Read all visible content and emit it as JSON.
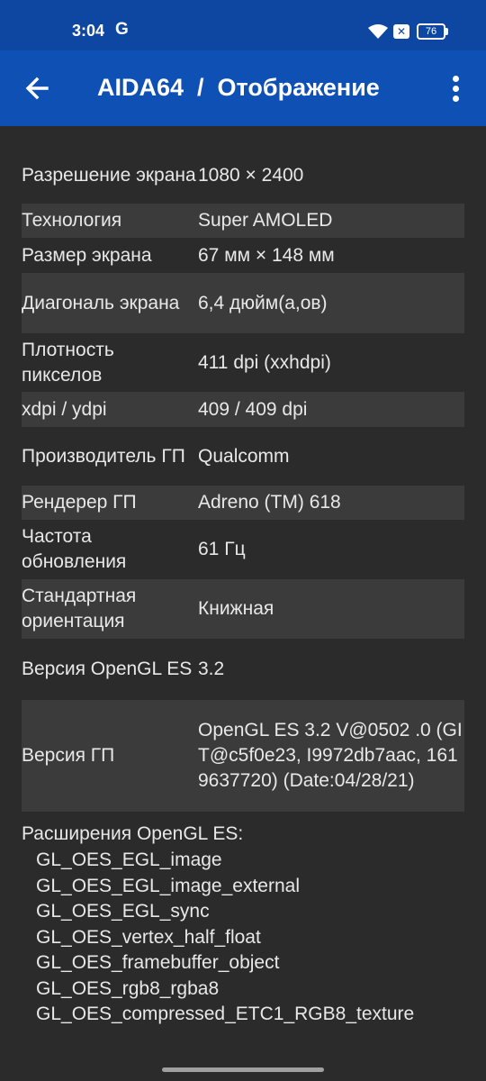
{
  "status_bar": {
    "time": "3:04",
    "g_icon": "G",
    "battery_level": "76",
    "icons": [
      "wifi-icon",
      "notification-x-icon",
      "battery-icon"
    ]
  },
  "app_bar": {
    "title": "AIDA64  /  Отображение",
    "back_icon": "arrow-left-icon",
    "menu_icon": "more-vert-icon",
    "color": "#0f50b4"
  },
  "rows": [
    {
      "label": "Разрешение экрана",
      "value": "1080 × 2400"
    },
    {
      "label": "Технология",
      "value": "Super AMOLED"
    },
    {
      "label": "Размер экрана",
      "value": "67 мм × 148 мм"
    },
    {
      "label": "Диагональ экрана",
      "value": "6,4 дюйм(а,ов)"
    },
    {
      "label": "Плотность пикселов",
      "value": "411 dpi (xxhdpi)"
    },
    {
      "label": "xdpi / ydpi",
      "value": "409 / 409 dpi"
    },
    {
      "label": "Производитель ГП",
      "value": "Qualcomm"
    },
    {
      "label": "Рендерер ГП",
      "value": "Adreno (TM) 618"
    },
    {
      "label": "Частота обновления",
      "value": "61 Гц"
    },
    {
      "label": "Стандартная ориентация",
      "value": "Книжная"
    },
    {
      "label": "Версия OpenGL ES",
      "value": "3.2"
    },
    {
      "label": "Версия ГП",
      "value": "OpenGL ES 3.2 V@0502 .0 (GIT@c5f0e23, I9972db7aac, 1619637720) (Date:04/28/21)"
    }
  ],
  "extensions": {
    "title": "Расширения OpenGL ES:",
    "items": [
      "GL_OES_EGL_image",
      "GL_OES_EGL_image_external",
      "GL_OES_EGL_sync",
      "GL_OES_vertex_half_float",
      "GL_OES_framebuffer_object",
      "GL_OES_rgb8_rgba8",
      "GL_OES_compressed_ETC1_RGB8_texture"
    ]
  }
}
